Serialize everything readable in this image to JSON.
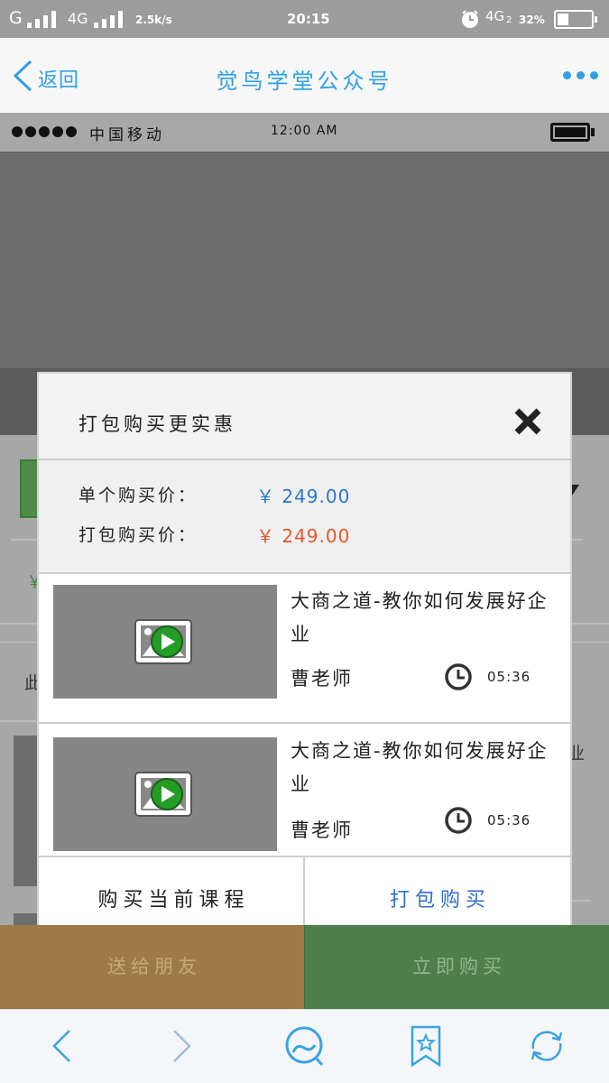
{
  "colors": {
    "accent_blue": "#2fa0e4",
    "single_price": "#2b78cf",
    "bundle_price": "#e8572b",
    "bundle_button": "#2e6fcf",
    "play_green": "#239c23",
    "gift_button": "#9e7a47",
    "buy_button": "#4d7e4b"
  },
  "status_bar": {
    "network1": "G",
    "network1b": "4G",
    "speed": "2.5k/s",
    "time": "20:15",
    "network2": "4G",
    "sim_index": "2",
    "battery": "32%",
    "icons": [
      "signal-icon",
      "alarm-icon",
      "battery-icon"
    ]
  },
  "nav": {
    "back_label": "返回",
    "title": "觉鸟学堂公众号",
    "icons": [
      "chevron-left-icon",
      "more-dots-icon"
    ]
  },
  "mock_status": {
    "carrier": "中国移动",
    "time": "12:00 AM",
    "icons": [
      "signal-dots-icon",
      "battery-icon"
    ]
  },
  "background": {
    "price_symbol": "￥",
    "text_left": "此",
    "text_right": "业"
  },
  "modal": {
    "title": "打包购买更实惠",
    "prices": [
      {
        "label": "单个购买价：",
        "value": "￥ 249.00"
      },
      {
        "label": "打包购买价：",
        "value": "￥ 249.00"
      }
    ],
    "courses": [
      {
        "title": "大商之道-教你如何发展好企业",
        "teacher": "曹老师",
        "duration": "05:36"
      },
      {
        "title": "大商之道-教你如何发展好企业",
        "teacher": "曹老师",
        "duration": "05:36"
      }
    ],
    "buttons": {
      "single": "购买当前课程",
      "bundle": "打包购买"
    },
    "icons": [
      "close-icon",
      "video-play-icon",
      "clock-icon"
    ]
  },
  "footer": {
    "gift": "送给朋友",
    "buy": "立即购买"
  },
  "toolbar": {
    "icons": [
      "back-icon",
      "forward-icon",
      "home-bubble-icon",
      "bookmark-star-icon",
      "refresh-icon"
    ]
  }
}
